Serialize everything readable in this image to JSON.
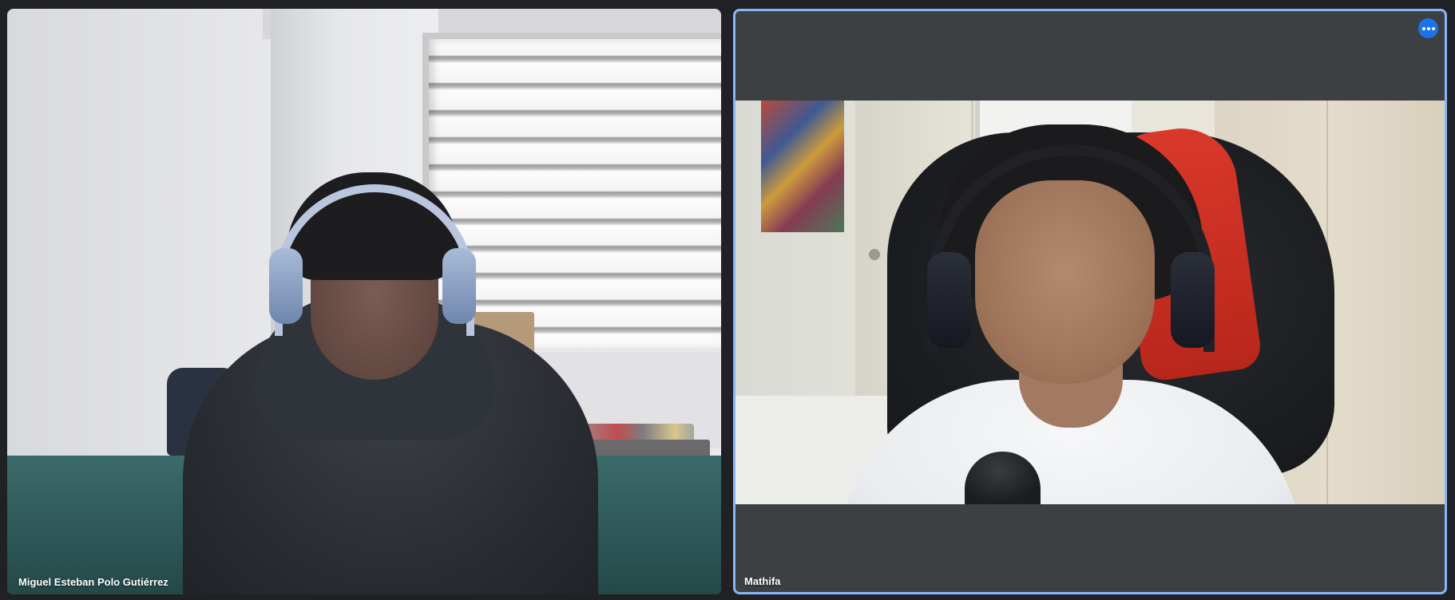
{
  "participants": [
    {
      "name": "Miguel Esteban Polo Gutiérrez",
      "pinned": false
    },
    {
      "name": "Mathifa",
      "pinned": true,
      "active_speaker": true,
      "more_options_icon": "more-horiz-icon"
    }
  ],
  "colors": {
    "background": "#202124",
    "tile_background": "#3c4043",
    "active_border": "#8ab4f8",
    "more_button": "#1a73e8"
  }
}
